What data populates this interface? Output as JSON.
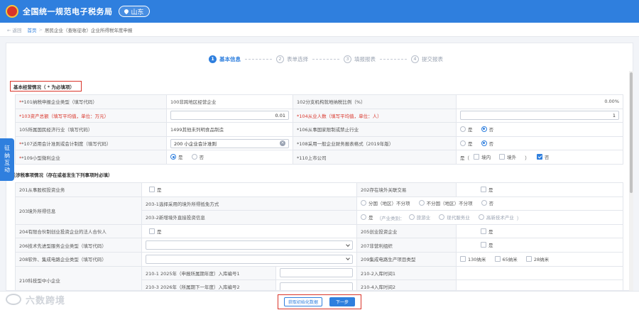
{
  "header": {
    "app_title": "全国统一规范电子税务局",
    "region": "山东"
  },
  "breadcrumb": {
    "back": "返回",
    "home": "首页",
    "current": "居民企业（查账征收）企业所得税年度申报"
  },
  "steps": [
    {
      "num": "1",
      "label": "基本信息"
    },
    {
      "num": "2",
      "label": "表单选择"
    },
    {
      "num": "3",
      "label": "填报报表"
    },
    {
      "num": "4",
      "label": "提交报表"
    }
  ],
  "section1": {
    "title": "基本经营情况（ * 为必填项）",
    "rows": [
      {
        "l1": "*101纳税申报企业类型（填写代码）",
        "v1": "100非跨地区经营企业",
        "l2": "102分支机构就地纳税比例（%）",
        "v2": "0.00%"
      },
      {
        "l1": "*103资产总额（",
        "h1": "填写平均值，单位：万元",
        "l1e": "）",
        "v1": "0.01",
        "l2": "*104从业人数（",
        "h2": "填写平均值，单位：人",
        "l2e": "）",
        "v2": "1"
      },
      {
        "l1": "105所属国民经济行业（填写代码）",
        "v1": "1499其他未列明食品制造",
        "l2": "*106从事国家限制或禁止行业",
        "o1": "是",
        "o2": "否"
      },
      {
        "l1": "*107适用会计准则或会计制度（填写代码）",
        "v1": "200 小企业会计准则",
        "l2": "*108采用一般企业财务报表格式（2019年版）",
        "o1": "是",
        "o2": "否"
      },
      {
        "l1": "*109小型微利企业",
        "o1": "是",
        "o2": "否",
        "l2": "*110上市公司",
        "pre": "是（",
        "c1": "境内",
        "c2": "境外",
        "post": "）",
        "c3": "否"
      }
    ]
  },
  "section2": {
    "title": "有关涉税事项情况（存在或者发生下列事项时必填）",
    "r201": {
      "label": "201从事股权投资业务",
      "cb": "是",
      "label2": "202存在境外关联交易",
      "cb2": "是"
    },
    "r203": {
      "label": "203境外所得信息",
      "sub1": "203-1选择采用的境外所得抵免方式",
      "sub1_opts": [
        "分国（地区）不分项",
        "不分国（地区）不分项",
        "否"
      ],
      "sub2": "203-2新增境外直接投资信息",
      "sub2_pre": "是",
      "sub2_mid": "（产业类别：",
      "sub2_opts": [
        "旅游业",
        "现代服务业",
        "高新技术产业"
      ],
      "sub2_post": "）"
    },
    "r204": {
      "label": "204有限合伙制创业投资企业的法人合伙人",
      "cb": "是",
      "label2": "205创业投资企业",
      "cb2": "是"
    },
    "r206": {
      "label": "206技术先进型服务企业类型（填写代码）",
      "label2": "207非营利组织",
      "cb2": "是"
    },
    "r208": {
      "label": "208软件、集成电路企业类型（填写代码）",
      "label2": "209集成电路生产项目类型",
      "opts": [
        "130纳米",
        "65纳米",
        "28纳米"
      ]
    },
    "r210": {
      "label": "210科技型中小企业",
      "sub1": "210-1  2025年（申报所属期年度）入库编号1",
      "sub1b": "210-2入库时间1",
      "sub2": "210-3  2026年（所属期下一年度）入库编号2",
      "sub2b": "210-4入库时间2"
    }
  },
  "side_tab": [
    "征",
    "纳",
    "互",
    "动"
  ],
  "buttons": {
    "fetch": "获取初始化数据",
    "next": "下一步"
  },
  "watermark": "六数跨境"
}
